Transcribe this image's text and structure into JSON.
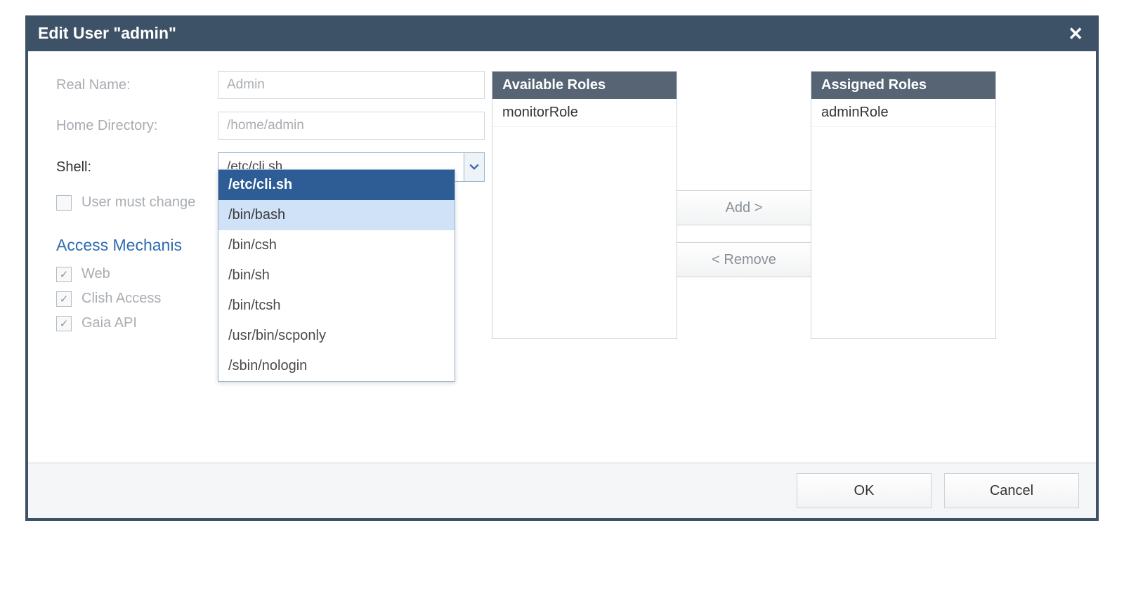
{
  "dialog": {
    "title": "Edit User \"admin\""
  },
  "form": {
    "real_name_label": "Real Name:",
    "real_name_value": "Admin",
    "home_dir_label": "Home Directory:",
    "home_dir_value": "/home/admin",
    "shell_label": "Shell:",
    "shell_value": "/etc/cli.sh",
    "shell_options": [
      "/etc/cli.sh",
      "/bin/bash",
      "/bin/csh",
      "/bin/sh",
      "/bin/tcsh",
      "/usr/bin/scponly",
      "/sbin/nologin"
    ],
    "shell_selected_index": 0,
    "shell_hover_index": 1,
    "must_change_label": "User must change",
    "must_change_checked": false,
    "section_title": "Access Mechanis",
    "access": [
      {
        "label": "Web",
        "checked": true
      },
      {
        "label": "Clish Access",
        "checked": true
      },
      {
        "label": "Gaia API",
        "checked": true
      }
    ]
  },
  "roles": {
    "available_header": "Available Roles",
    "assigned_header": "Assigned Roles",
    "available": [
      "monitorRole"
    ],
    "assigned": [
      "adminRole"
    ],
    "add_label": "Add >",
    "remove_label": "< Remove"
  },
  "footer": {
    "ok": "OK",
    "cancel": "Cancel"
  }
}
